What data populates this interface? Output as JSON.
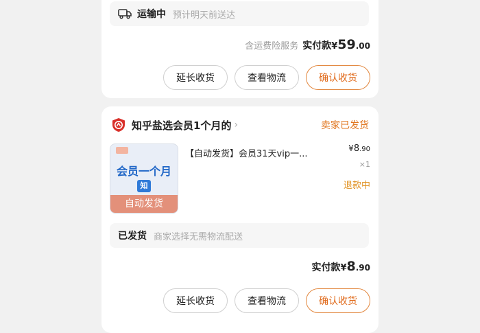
{
  "order1": {
    "shipping_status": "运输中",
    "shipping_note": "预计明天前送达",
    "insurance_note": "含运费险服务",
    "paid_label": "实付款",
    "currency": "¥",
    "paid_int": "59",
    "paid_dec": ".00",
    "buttons": {
      "extend": "延长收货",
      "logistics": "查看物流",
      "confirm": "确认收货"
    }
  },
  "order2": {
    "shop_name": "知乎盐选会员1个月的",
    "seller_status": "卖家已发货",
    "product": {
      "image_title": "会员一个月",
      "image_badge": "知",
      "image_banner": "自动发货",
      "title": "【自动发货】会员31天vip一...",
      "price_symbol": "¥",
      "price_int": "8",
      "price_dec": ".90",
      "quantity": "×1",
      "refund_status": "退款中"
    },
    "shipping_status": "已发货",
    "shipping_note": "商家选择无需物流配送",
    "paid_label": "实付款",
    "currency": "¥",
    "paid_int": "8",
    "paid_dec": ".90",
    "buttons": {
      "extend": "延长收货",
      "logistics": "查看物流",
      "confirm": "确认收货"
    }
  },
  "colors": {
    "accent": "#e06a1b",
    "background": "#f1f1f1",
    "refund": "#e0901e"
  }
}
